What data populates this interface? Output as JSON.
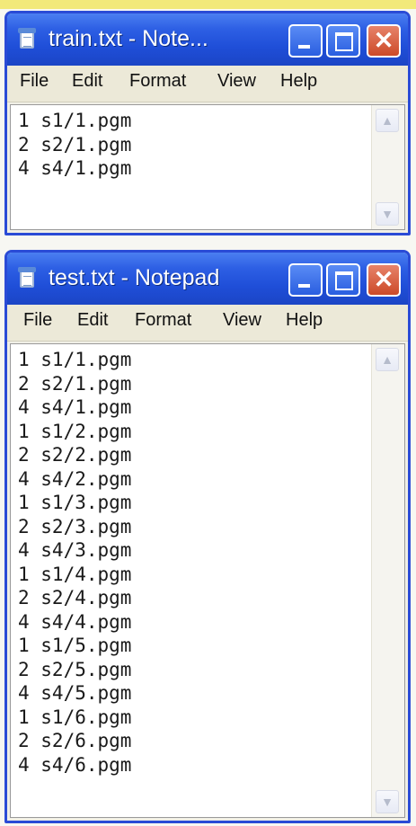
{
  "windows": {
    "train": {
      "title": "train.txt - Note...",
      "menu": [
        "File",
        "Edit",
        "Format",
        "View",
        "Help"
      ],
      "lines": [
        "1 s1/1.pgm",
        "2 s2/1.pgm",
        "4 s4/1.pgm"
      ]
    },
    "test": {
      "title": "test.txt - Notepad",
      "menu": [
        "File",
        "Edit",
        "Format",
        "View",
        "Help"
      ],
      "lines": [
        "1 s1/1.pgm",
        "2 s2/1.pgm",
        "4 s4/1.pgm",
        "1 s1/2.pgm",
        "2 s2/2.pgm",
        "4 s4/2.pgm",
        "1 s1/3.pgm",
        "2 s2/3.pgm",
        "4 s4/3.pgm",
        "1 s1/4.pgm",
        "2 s2/4.pgm",
        "4 s4/4.pgm",
        "1 s1/5.pgm",
        "2 s2/5.pgm",
        "4 s4/5.pgm",
        "1 s1/6.pgm",
        "2 s2/6.pgm",
        "4 s4/6.pgm"
      ]
    }
  },
  "icons": {
    "app": "notepad-icon",
    "minimize": "minimize-icon",
    "maximize": "maximize-icon",
    "close": "close-icon",
    "scroll_up": "scroll-up-arrow-icon",
    "scroll_down": "scroll-down-arrow-icon"
  },
  "colors": {
    "titlebar": "#2d5fe4",
    "close_button": "#d9553a",
    "menubar": "#ece9d8"
  }
}
